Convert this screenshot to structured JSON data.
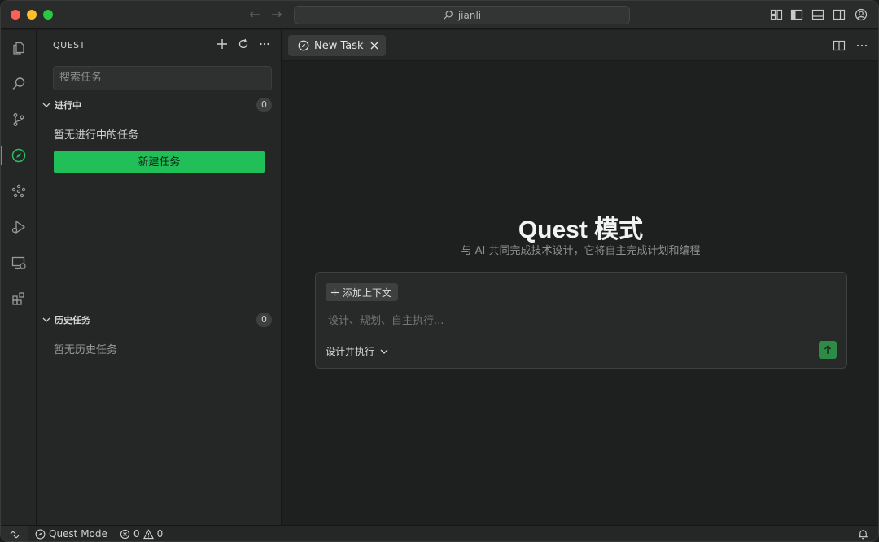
{
  "window": {
    "search_text": "jianli"
  },
  "sidebar": {
    "title": "QUEST",
    "search_placeholder": "搜索任务",
    "in_progress": {
      "label": "进行中",
      "count": "0",
      "empty_text": "暂无进行中的任务",
      "new_button": "新建任务"
    },
    "history": {
      "label": "历史任务",
      "count": "0",
      "empty_text": "暂无历史任务"
    }
  },
  "editor": {
    "tab_label": "New Task",
    "hero_title": "Quest 模式",
    "hero_subtitle": "与 AI 共同完成技术设计，它将自主完成计划和编程",
    "composer": {
      "context_button": "添加上下文",
      "placeholder": "设计、规划、自主执行...",
      "mode_label": "设计并执行"
    }
  },
  "statusbar": {
    "mode": "Quest Mode",
    "errors": "0",
    "warnings": "0"
  },
  "colors": {
    "accent": "#21bf57",
    "send": "#2e8a47"
  }
}
